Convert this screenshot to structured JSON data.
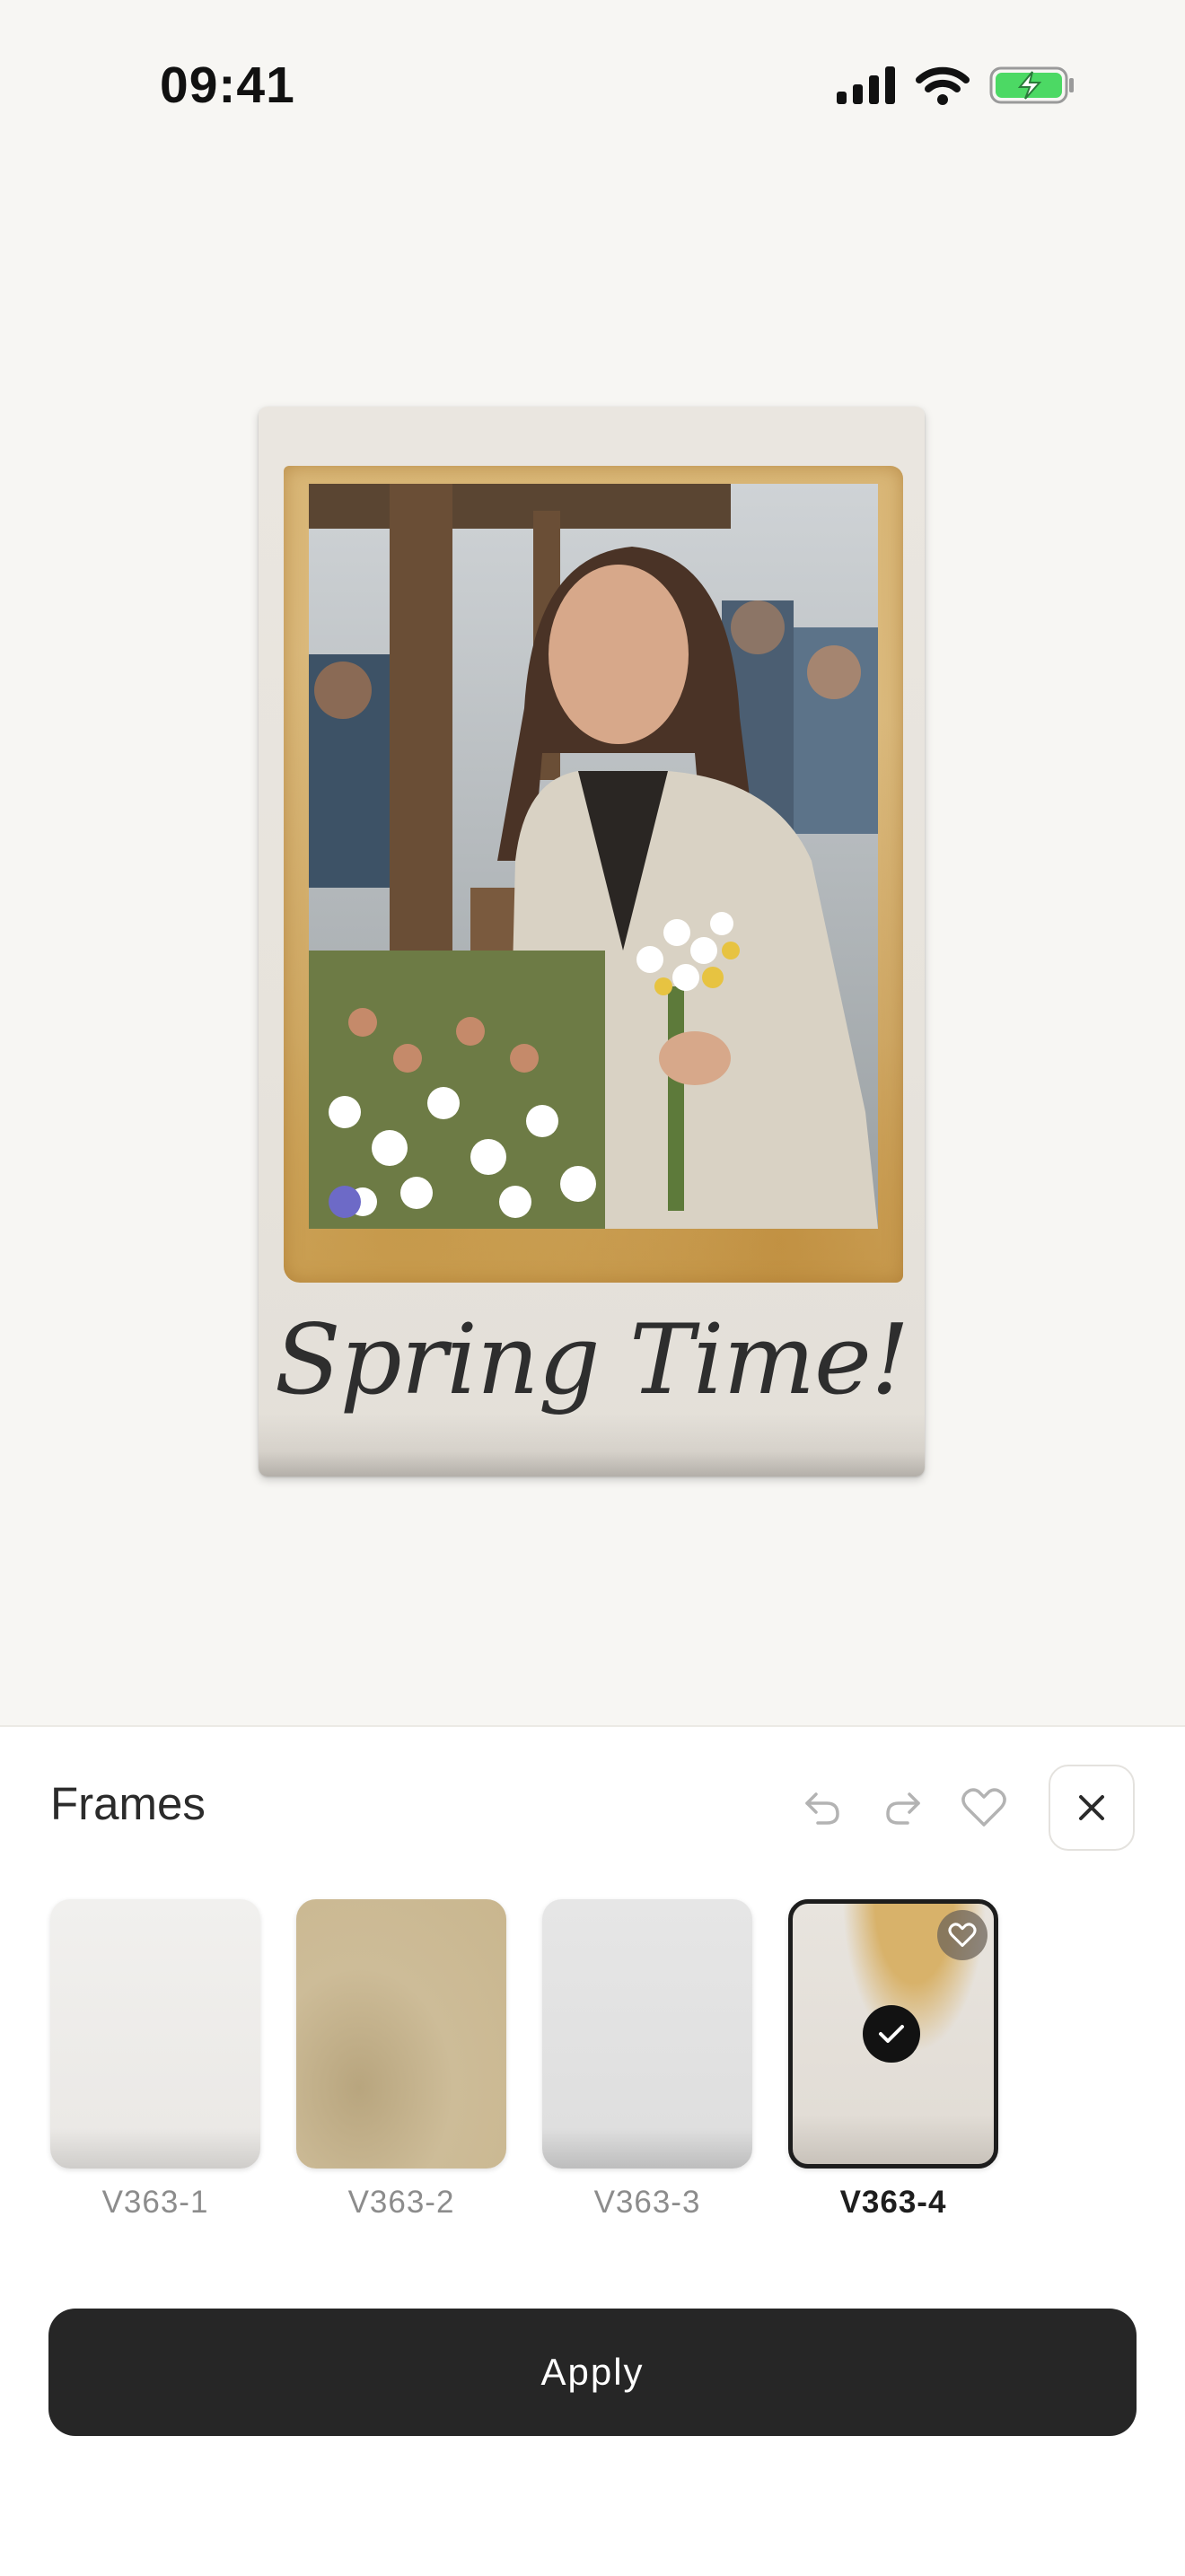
{
  "status_bar": {
    "time": "09:41"
  },
  "preview": {
    "caption": "Spring Time!"
  },
  "sheet": {
    "title": "Frames",
    "frames": [
      {
        "label": "V363-1",
        "selected": false
      },
      {
        "label": "V363-2",
        "selected": false
      },
      {
        "label": "V363-3",
        "selected": false
      },
      {
        "label": "V363-4",
        "selected": true
      }
    ],
    "apply_label": "Apply"
  },
  "colors": {
    "background": "#f7f6f3",
    "sheet": "#ffffff",
    "apply_button": "#262626",
    "battery_fill": "#4cd964"
  },
  "icons": [
    "signal-icon",
    "wifi-icon",
    "battery-charging-icon",
    "undo-icon",
    "redo-icon",
    "heart-icon",
    "close-icon",
    "checkmark-icon"
  ]
}
